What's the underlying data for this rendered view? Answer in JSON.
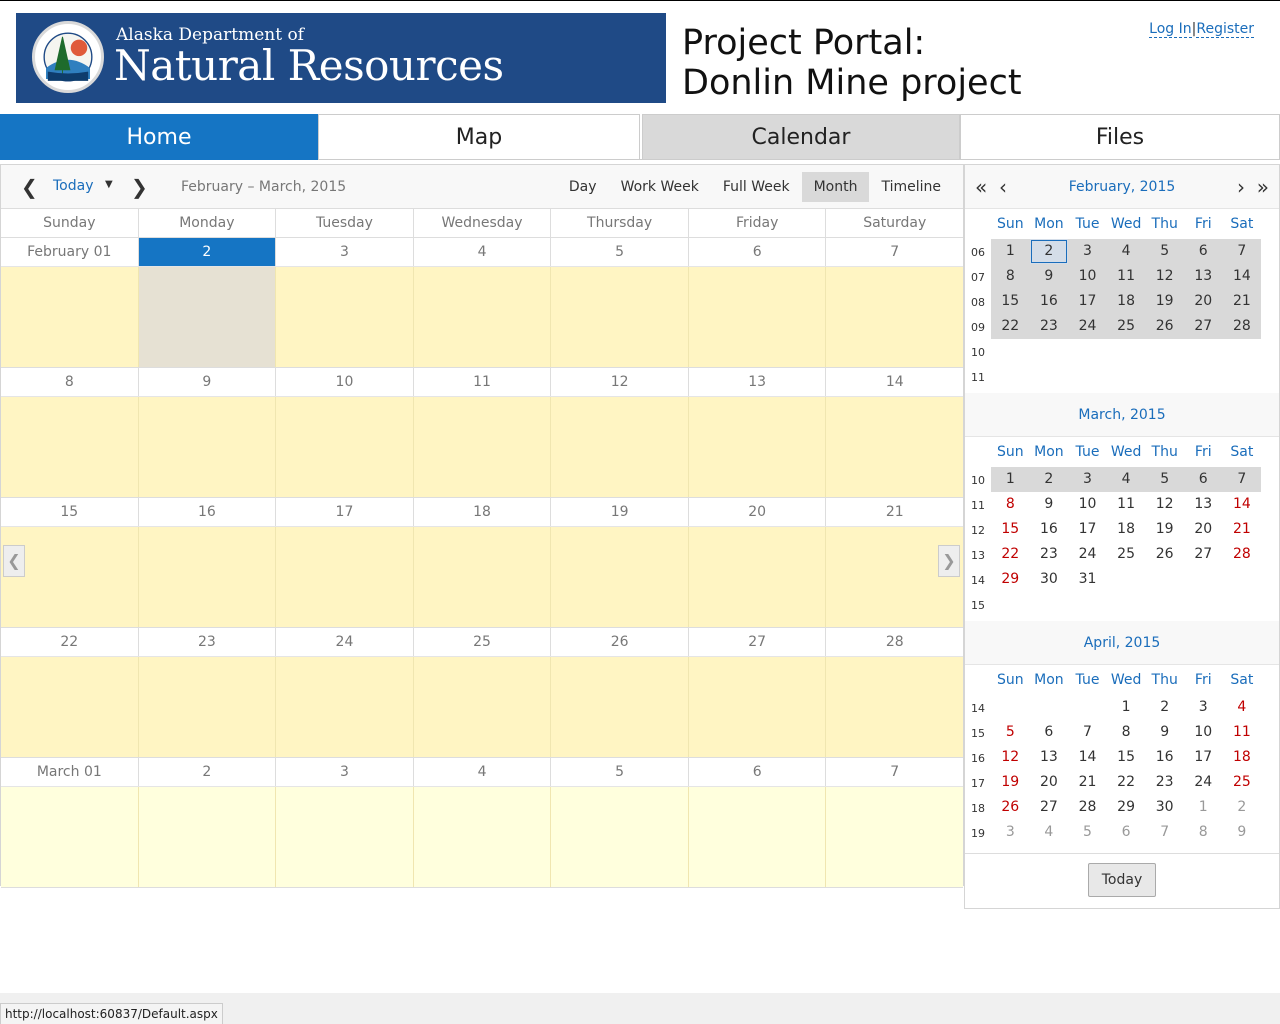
{
  "header": {
    "agency_line1": "Alaska Department of",
    "agency_line2": "Natural Resources",
    "portal_line1": "Project Portal:",
    "portal_line2": "Donlin Mine project",
    "login": "Log In",
    "separator": "|",
    "register": "Register"
  },
  "nav": {
    "home": "Home",
    "map": "Map",
    "calendar": "Calendar",
    "files": "Files"
  },
  "toolbar": {
    "prev": "❮",
    "next": "❯",
    "today": "Today",
    "dropdown": "▼",
    "range": "February – March, 2015",
    "views": [
      "Day",
      "Work Week",
      "Full Week",
      "Month",
      "Timeline"
    ],
    "active_view": "Month"
  },
  "scheduler": {
    "day_names": [
      "Sunday",
      "Monday",
      "Tuesday",
      "Wednesday",
      "Thursday",
      "Friday",
      "Saturday"
    ],
    "weeks": [
      [
        "February 01",
        "2",
        "3",
        "4",
        "5",
        "6",
        "7"
      ],
      [
        "8",
        "9",
        "10",
        "11",
        "12",
        "13",
        "14"
      ],
      [
        "15",
        "16",
        "17",
        "18",
        "19",
        "20",
        "21"
      ],
      [
        "22",
        "23",
        "24",
        "25",
        "26",
        "27",
        "28"
      ],
      [
        "March 01",
        "2",
        "3",
        "4",
        "5",
        "6",
        "7"
      ]
    ],
    "side_prev": "❮",
    "side_next": "❯"
  },
  "minical": {
    "nav_first": "«",
    "nav_prev": "‹",
    "nav_next": "›",
    "nav_last": "»",
    "dow": [
      "Sun",
      "Mon",
      "Tue",
      "Wed",
      "Thu",
      "Fri",
      "Sat"
    ],
    "feb_title": "February, 2015",
    "mar_title": "March, 2015",
    "apr_title": "April, 2015",
    "today_button": "Today",
    "feb": {
      "weeks": [
        "06",
        "07",
        "08",
        "09",
        "10",
        "11"
      ],
      "rows": [
        [
          "1",
          "2",
          "3",
          "4",
          "5",
          "6",
          "7"
        ],
        [
          "8",
          "9",
          "10",
          "11",
          "12",
          "13",
          "14"
        ],
        [
          "15",
          "16",
          "17",
          "18",
          "19",
          "20",
          "21"
        ],
        [
          "22",
          "23",
          "24",
          "25",
          "26",
          "27",
          "28"
        ]
      ]
    },
    "mar": {
      "weeks": [
        "10",
        "11",
        "12",
        "13",
        "14",
        "15"
      ],
      "rows": [
        [
          "1",
          "2",
          "3",
          "4",
          "5",
          "6",
          "7"
        ],
        [
          "8",
          "9",
          "10",
          "11",
          "12",
          "13",
          "14"
        ],
        [
          "15",
          "16",
          "17",
          "18",
          "19",
          "20",
          "21"
        ],
        [
          "22",
          "23",
          "24",
          "25",
          "26",
          "27",
          "28"
        ],
        [
          "29",
          "30",
          "31",
          "",
          "",
          "",
          ""
        ]
      ]
    },
    "apr": {
      "weeks": [
        "14",
        "15",
        "16",
        "17",
        "18",
        "19"
      ],
      "rows": [
        [
          "",
          "",
          "",
          "1",
          "2",
          "3",
          "4"
        ],
        [
          "5",
          "6",
          "7",
          "8",
          "9",
          "10",
          "11"
        ],
        [
          "12",
          "13",
          "14",
          "15",
          "16",
          "17",
          "18"
        ],
        [
          "19",
          "20",
          "21",
          "22",
          "23",
          "24",
          "25"
        ],
        [
          "26",
          "27",
          "28",
          "29",
          "30",
          "1",
          "2"
        ],
        [
          "3",
          "4",
          "5",
          "6",
          "7",
          "8",
          "9"
        ]
      ]
    }
  },
  "status": {
    "url": "http://localhost:60837/Default.aspx"
  },
  "colors": {
    "accent": "#1575c4",
    "banner": "#1f4a86",
    "cell": "#fff5c3",
    "weekend": "#c00000"
  }
}
